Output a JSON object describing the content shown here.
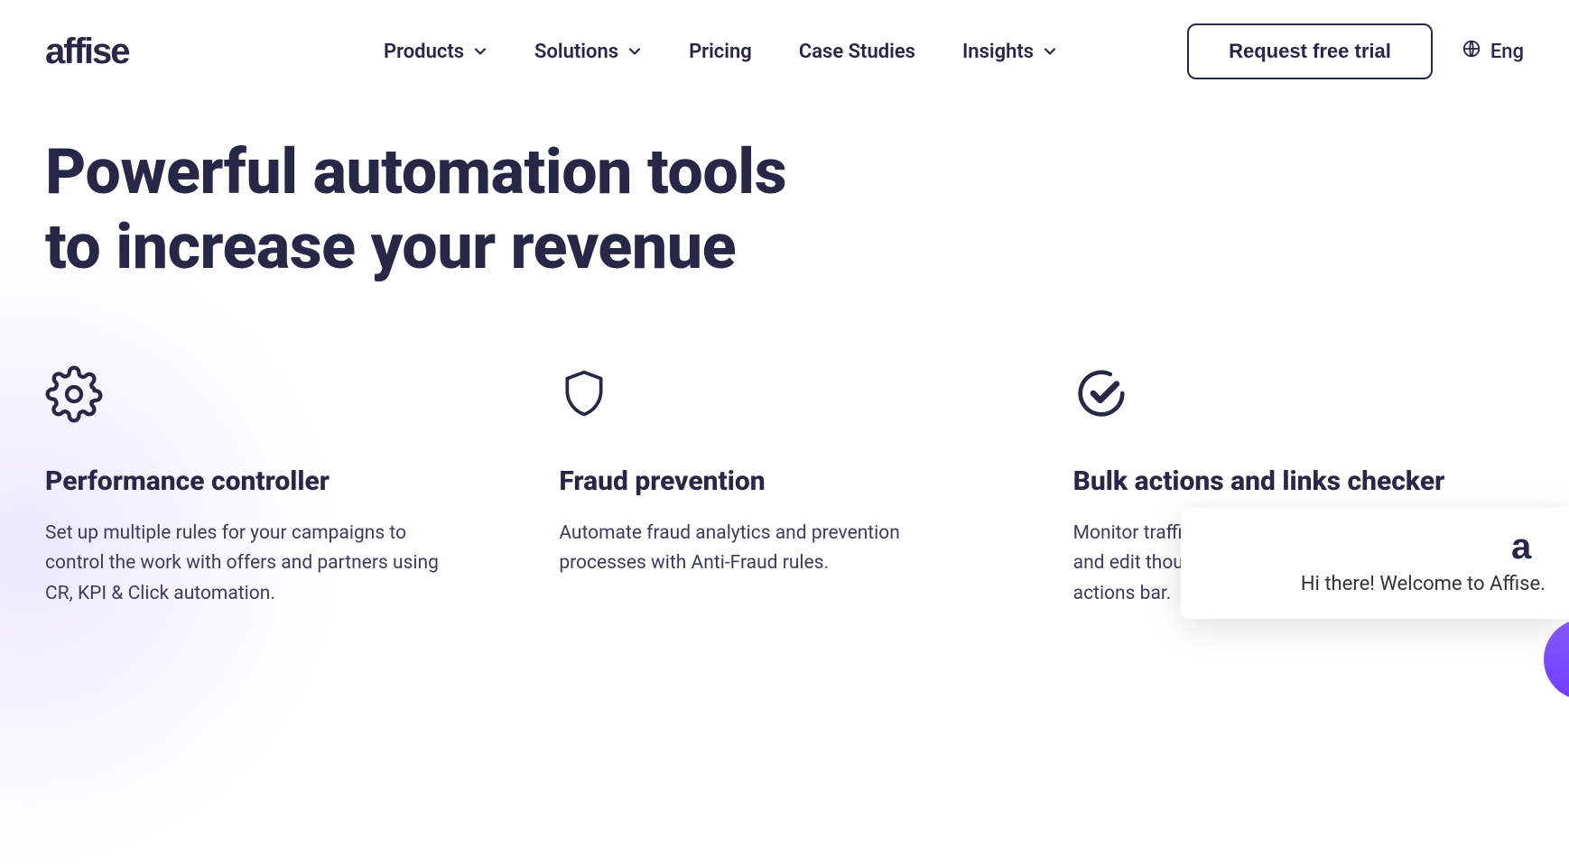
{
  "logo": {
    "text": "affise"
  },
  "nav": {
    "items": [
      {
        "label": "Products",
        "has_dropdown": true
      },
      {
        "label": "Solutions",
        "has_dropdown": true
      },
      {
        "label": "Pricing",
        "has_dropdown": false
      },
      {
        "label": "Case Studies",
        "has_dropdown": false
      },
      {
        "label": "Insights",
        "has_dropdown": true
      }
    ]
  },
  "cta": {
    "label": "Request free trial"
  },
  "language": {
    "label": "Eng"
  },
  "hero": {
    "title_line1": "Powerful automation tools",
    "title_line2": "to increase your revenue"
  },
  "features": [
    {
      "icon": "gear-icon",
      "title": "Performance controller",
      "body": "Set up multiple rules for your campaigns to control the work with offers and partners using CR, KPI & Click automation."
    },
    {
      "icon": "shield-icon",
      "title": "Fraud prevention",
      "body": "Automate fraud analytics and prevention processes with Anti-Fraud rules."
    },
    {
      "icon": "check-circle-icon",
      "title": "Bulk actions and links checker",
      "body": "Monitor traffic you work with using Checker and edit thousands of offers with a bulk actions bar."
    }
  ],
  "chat": {
    "message": "Hi there! Welcome to Affise."
  }
}
